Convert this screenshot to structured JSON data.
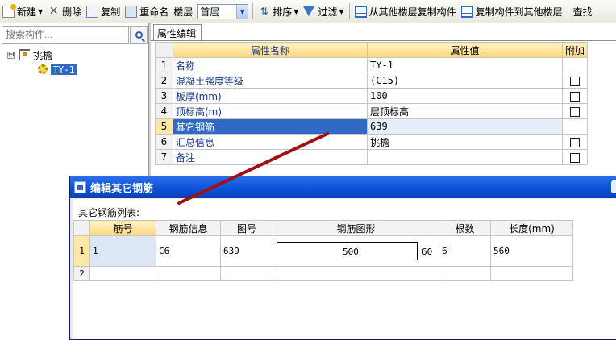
{
  "toolbar": {
    "new_label": "新建",
    "delete_label": "删除",
    "copy_label": "复制",
    "rename_label": "重命名",
    "floor_label": "楼层",
    "floor_value": "首层",
    "sort_label": "排序",
    "filter_label": "过滤",
    "copy_from_floor_label": "从其他楼层复制构件",
    "copy_to_floor_label": "复制构件到其他楼层",
    "find_label": "查找"
  },
  "left_panel": {
    "search_placeholder": "搜索构件...",
    "tree": {
      "root_label": "挑檐",
      "root_expander": "⊟",
      "child_label": "TY-1"
    }
  },
  "properties": {
    "tab_label": "属性编辑",
    "headers": {
      "name": "属性名称",
      "value": "属性值",
      "extra": "附加"
    },
    "rows": [
      {
        "num": "1",
        "name": "名称",
        "value": "TY-1",
        "checkbox": false
      },
      {
        "num": "2",
        "name": "混凝土强度等级",
        "value": "(C15)",
        "checkbox": true
      },
      {
        "num": "3",
        "name": "板厚(mm)",
        "value": "100",
        "checkbox": true
      },
      {
        "num": "4",
        "name": "顶标高(m)",
        "value": "层顶标高",
        "checkbox": true
      },
      {
        "num": "5",
        "name": "其它钢筋",
        "value": "639",
        "checkbox": false,
        "selected": true
      },
      {
        "num": "6",
        "name": "汇总信息",
        "value": "挑檐",
        "checkbox": true
      },
      {
        "num": "7",
        "name": "备注",
        "value": "",
        "checkbox": true
      }
    ]
  },
  "dialog": {
    "title": "编辑其它钢筋",
    "list_label": "其它钢筋列表:",
    "headers": {
      "bar_no": "筋号",
      "bar_info": "钢筋信息",
      "shape_no": "图号",
      "shape": "钢筋图形",
      "count": "根数",
      "length": "长度(mm)"
    },
    "rows": [
      {
        "num": "1",
        "bar_no": "1",
        "bar_info": "C6",
        "shape_no": "639",
        "shape_len": "500",
        "shape_hook": "60",
        "count": "6",
        "length": "560"
      },
      {
        "num": "2",
        "bar_no": "",
        "bar_info": "",
        "shape_no": "",
        "shape_len": "",
        "shape_hook": "",
        "count": "",
        "length": ""
      }
    ]
  },
  "colors": {
    "selection_blue": "#316ac5",
    "header_gold": "#ffd77a",
    "annotation_red": "#a01010",
    "dialog_title_blue": "#0a50d8"
  }
}
